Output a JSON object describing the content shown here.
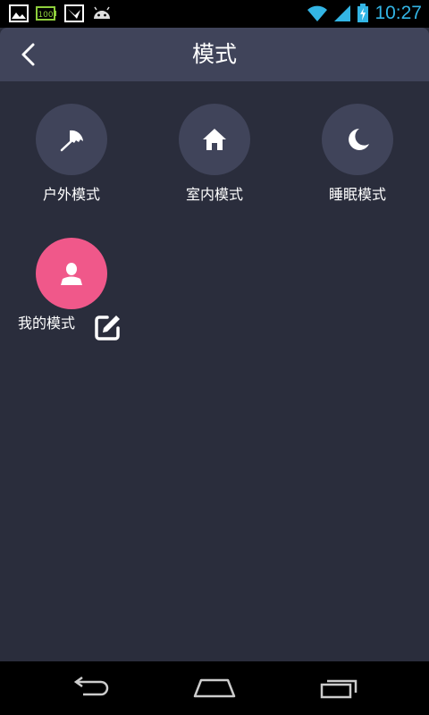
{
  "statusbar": {
    "time": "10:27",
    "battery_badge": "100",
    "icons": [
      "image-icon",
      "battery-100-icon",
      "bird-icon",
      "android-icon",
      "wifi-icon",
      "signal-icon",
      "battery-charging-icon"
    ]
  },
  "header": {
    "title": "模式",
    "back_icon": "chevron-left-icon"
  },
  "modes": [
    {
      "label": "户外模式",
      "icon": "umbrella-icon"
    },
    {
      "label": "室内模式",
      "icon": "home-icon"
    },
    {
      "label": "睡眠模式",
      "icon": "moon-icon"
    }
  ],
  "my_mode": {
    "label": "我的模式",
    "icon": "user-icon",
    "edit_icon": "edit-icon"
  },
  "navbar": {
    "icons": [
      "back-icon",
      "home-icon",
      "recent-apps-icon"
    ]
  },
  "colors": {
    "background": "#2a2d3c",
    "titlebar": "#40445a",
    "circle": "#40445a",
    "accent_pink": "#f0588a",
    "time": "#33b5e5"
  }
}
